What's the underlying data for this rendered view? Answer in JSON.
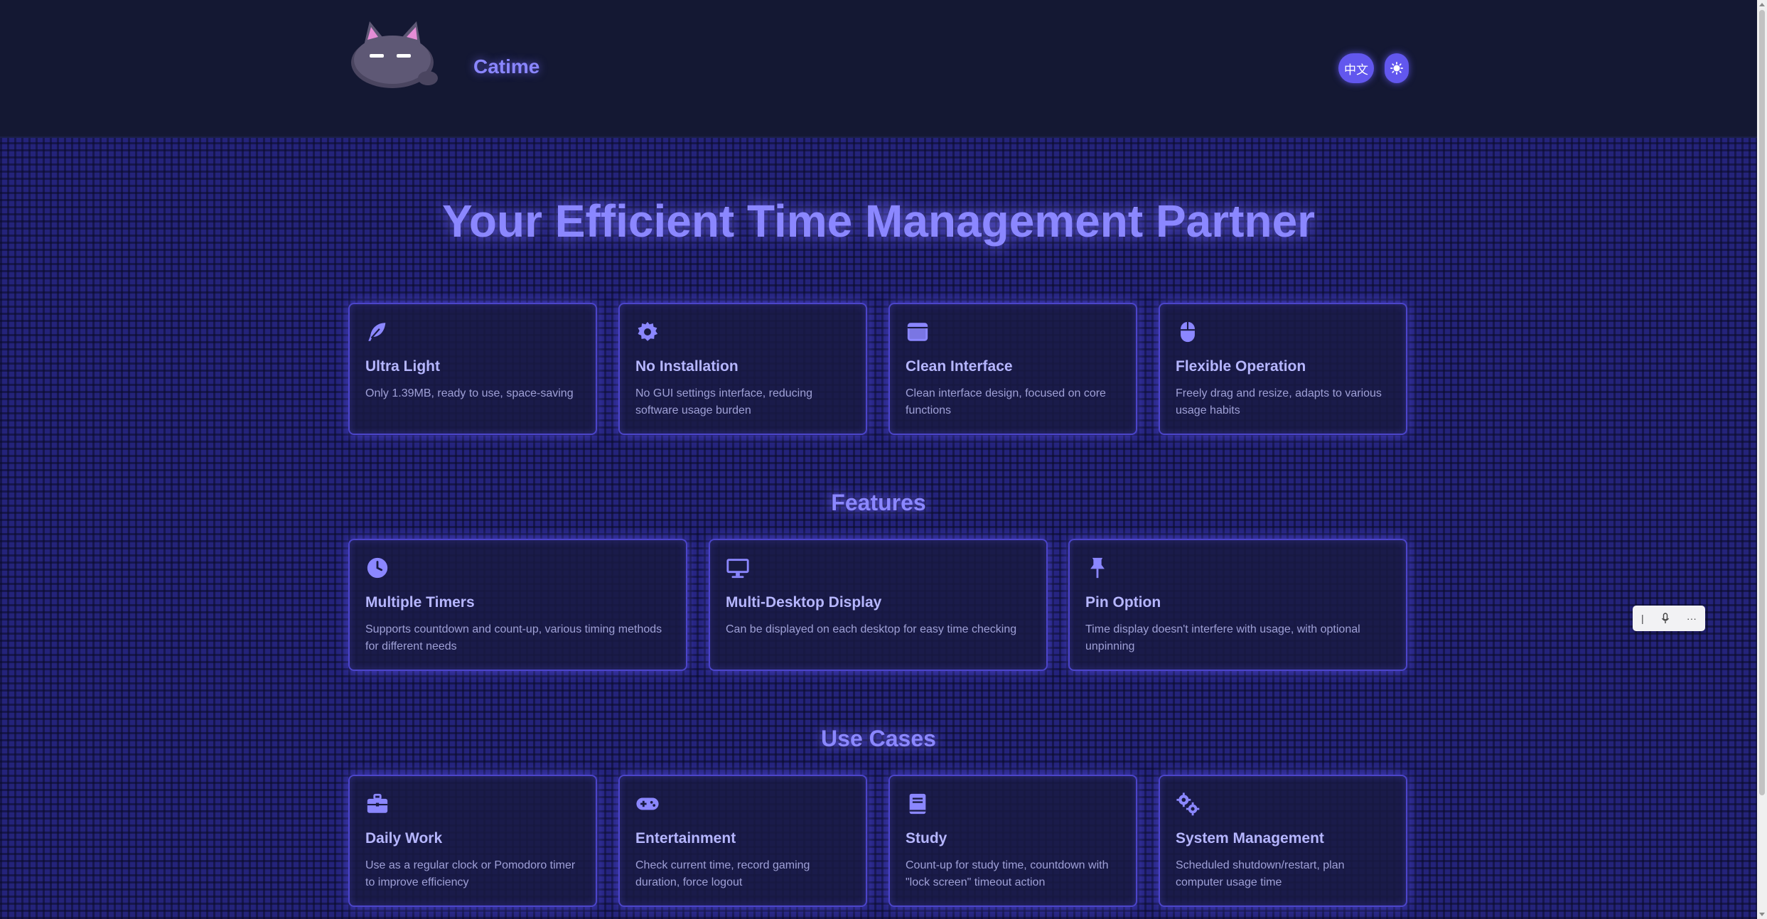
{
  "header": {
    "brand": "Catime",
    "lang_button": "中文",
    "theme_icon": "sun-icon",
    "logo_icon": "cat-logo-icon"
  },
  "hero": {
    "title": "Your Efficient Time Management Partner"
  },
  "highlights": [
    {
      "icon": "feather-icon",
      "title": "Ultra Light",
      "desc": "Only 1.39MB, ready to use, space-saving"
    },
    {
      "icon": "gear-icon",
      "title": "No Installation",
      "desc": "No GUI settings interface, reducing software usage burden"
    },
    {
      "icon": "window-icon",
      "title": "Clean Interface",
      "desc": "Clean interface design, focused on core functions"
    },
    {
      "icon": "mouse-icon",
      "title": "Flexible Operation",
      "desc": "Freely drag and resize, adapts to various usage habits"
    }
  ],
  "features": {
    "title": "Features",
    "items": [
      {
        "icon": "clock-icon",
        "title": "Multiple Timers",
        "desc": "Supports countdown and count-up, various timing methods for different needs"
      },
      {
        "icon": "desktop-icon",
        "title": "Multi-Desktop Display",
        "desc": "Can be displayed on each desktop for easy time checking"
      },
      {
        "icon": "pin-icon",
        "title": "Pin Option",
        "desc": "Time display doesn't interfere with usage, with optional unpinning"
      }
    ]
  },
  "use_cases": {
    "title": "Use Cases",
    "items": [
      {
        "icon": "briefcase-icon",
        "title": "Daily Work",
        "desc": "Use as a regular clock or Pomodoro timer to improve efficiency"
      },
      {
        "icon": "gamepad-icon",
        "title": "Entertainment",
        "desc": "Check current time, record gaming duration, force logout"
      },
      {
        "icon": "book-icon",
        "title": "Study",
        "desc": "Count-up for study time, countdown with \"lock screen\" timeout action"
      },
      {
        "icon": "gears-icon",
        "title": "System Management",
        "desc": "Scheduled shutdown/restart, plan computer usage time"
      }
    ]
  },
  "floating_toolbar": {
    "items": [
      "cursor-icon",
      "microphone-icon",
      "more-icon"
    ]
  },
  "colors": {
    "accent": "#8b87ff",
    "button": "#6257ee",
    "background": "#141833",
    "grid": "#24237a"
  }
}
